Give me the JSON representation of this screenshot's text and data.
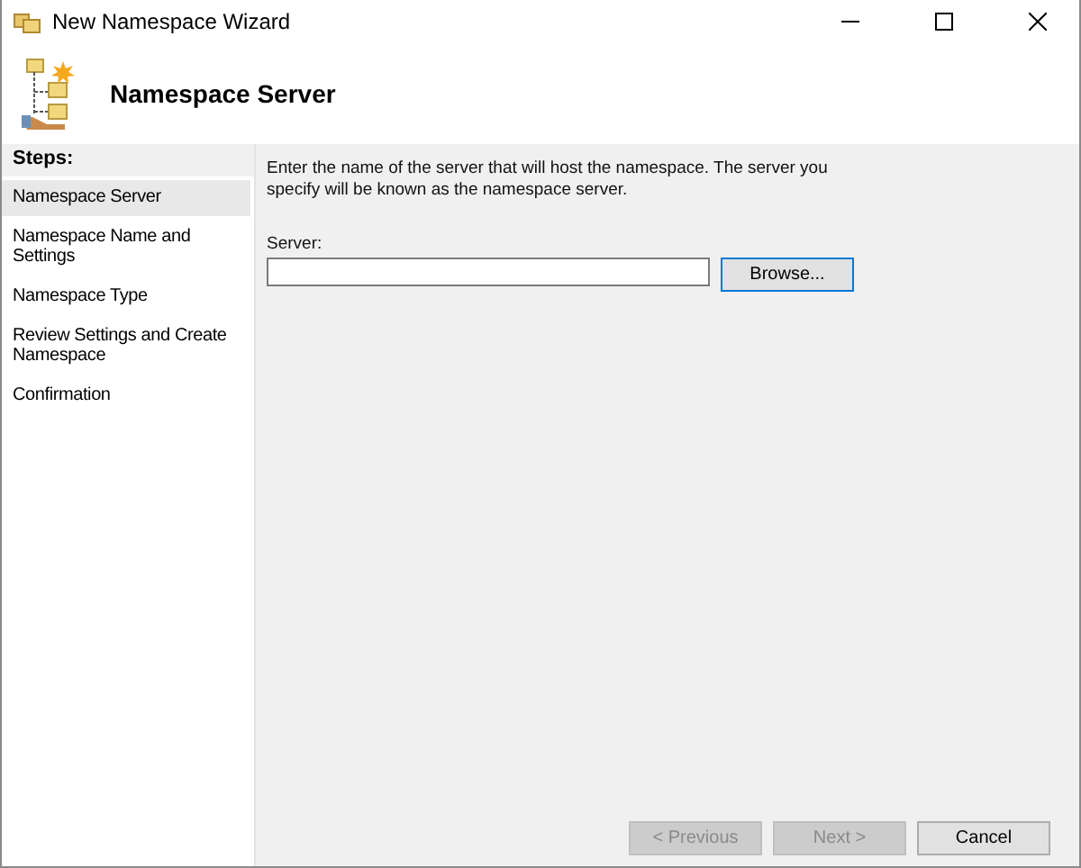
{
  "window": {
    "title": "New Namespace Wizard"
  },
  "header": {
    "title": "Namespace Server"
  },
  "steps": {
    "title": "Steps:",
    "items": [
      {
        "label": "Namespace Server",
        "selected": true
      },
      {
        "label": "Namespace Name and Settings",
        "selected": false
      },
      {
        "label": "Namespace Type",
        "selected": false
      },
      {
        "label": "Review Settings and Create Namespace",
        "selected": false
      },
      {
        "label": "Confirmation",
        "selected": false
      }
    ]
  },
  "content": {
    "description": "Enter the name of the server that will host the namespace. The server you specify will be known as the namespace server.",
    "server_label": "Server:",
    "browse_button": "Browse..."
  },
  "buttons": [
    {
      "label": "< Previous",
      "disabled": true
    },
    {
      "label": "Next >",
      "disabled": true
    },
    {
      "label": "Cancel",
      "disabled": false
    }
  ]
}
